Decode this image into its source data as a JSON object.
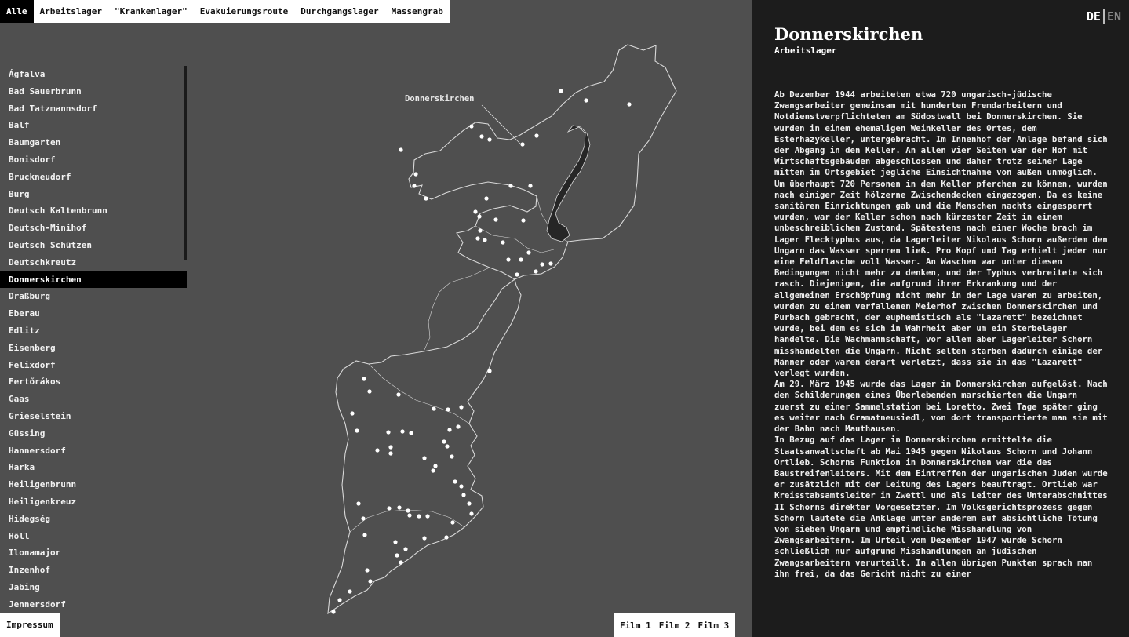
{
  "filters": [
    "Alle",
    "Arbeitslager",
    "\"Krankenlager\"",
    "Evakuierungsroute",
    "Durchgangslager",
    "Massengrab"
  ],
  "active_filter": "Alle",
  "places": [
    "Ágfalva",
    "Bad Sauerbrunn",
    "Bad Tatzmannsdorf",
    "Balf",
    "Baumgarten",
    "Bonisdorf",
    "Bruckneudorf",
    "Burg",
    "Deutsch Kaltenbrunn",
    "Deutsch-Minihof",
    "Deutsch Schützen",
    "Deutschkreutz",
    "Donnerskirchen",
    "Draßburg",
    "Eberau",
    "Edlitz",
    "Eisenberg",
    "Felixdorf",
    "Fertőrákos",
    "Gaas",
    "Grieselstein",
    "Güssing",
    "Hannersdorf",
    "Harka",
    "Heiligenbrunn",
    "Heiligenkreuz",
    "Hidegség",
    "Höll",
    "Ilonamajor",
    "Inzenhof",
    "Jabing",
    "Jennersdorf"
  ],
  "active_place": "Donnerskirchen",
  "map": {
    "callout_label": "Donnerskirchen",
    "colors": {
      "background": "#4f4f4f",
      "border": "#d8d8d8",
      "lake": "#262626",
      "marker": "#ffffff"
    }
  },
  "footer": {
    "impressum": "Impressum",
    "films": [
      "Film 1",
      "Film 2",
      "Film 3"
    ]
  },
  "language": {
    "de": "DE",
    "en": "EN",
    "active": "DE"
  },
  "info": {
    "title": "Donnerskirchen",
    "subtitle": "Arbeitslager",
    "paragraphs": [
      "Ab Dezember 1944 arbeiteten etwa 720 ungarisch-jüdische Zwangsarbeiter gemeinsam mit hunderten Fremdarbeitern und Notdienstverpflichteten am Südostwall bei Donnerskirchen. Sie wurden in einem ehemaligen Weinkeller des Ortes, dem Esterhazykeller, untergebracht. Im Innenhof der Anlage befand sich der Abgang in den Keller. An allen vier Seiten war der Hof mit Wirtschaftsgebäuden abgeschlossen und daher trotz seiner Lage mitten im Ortsgebiet jegliche Einsichtnahme von außen unmöglich. Um überhaupt 720 Personen in den Keller pferchen zu können, wurden nach einiger Zeit hölzerne Zwischendecken eingezogen. Da es keine sanitären Einrichtungen gab und die Menschen nachts eingesperrt wurden, war der Keller schon nach kürzester Zeit in einem unbeschreiblichen Zustand. Spätestens nach einer Woche brach im Lager Flecktyphus aus, da Lagerleiter Nikolaus Schorn außerdem den Ungarn das Wasser sperren ließ. Pro Kopf und Tag erhielt jeder nur eine Feldflasche voll Wasser. An Waschen war unter diesen Bedingungen nicht mehr zu denken, und der Typhus verbreitete sich rasch. Diejenigen, die aufgrund ihrer Erkrankung und der allgemeinen Erschöpfung nicht mehr in der Lage waren zu arbeiten, wurden zu einem verfallenen Meierhof zwischen Donnerskirchen und Purbach gebracht, der euphemistisch als \"Lazarett\" bezeichnet wurde, bei dem es sich in Wahrheit aber um ein Sterbelager handelte. Die Wachmannschaft, vor allem aber Lagerleiter Schorn misshandelten die Ungarn. Nicht selten starben dadurch einige der Männer oder waren derart verletzt, dass sie in das \"Lazarett\" verlegt wurden.",
      "Am 29. März 1945 wurde das Lager in Donnerskirchen aufgelöst. Nach den Schilderungen eines Überlebenden marschierten die Ungarn zuerst zu einer Sammelstation bei Loretto. Zwei Tage später ging es weiter nach Gramatneusiedl, von dort transportierte man sie mit der Bahn nach Mauthausen.",
      "In Bezug auf das Lager in Donnerskirchen ermittelte die Staatsanwaltschaft ab Mai 1945 gegen Nikolaus Schorn und Johann Ortlieb. Schorns Funktion in Donnerskirchen war die des Baustreifenleiters. Mit dem Eintreffen der ungarischen Juden wurde er zusätzlich mit der Leitung des Lagers beauftragt. Ortlieb war Kreisstabsamtsleiter in Zwettl und als Leiter des Unterabschnittes II Schorns direkter Vorgesetzter. Im Volksgerichtsprozess gegen Schorn lautete die Anklage unter anderem auf absichtliche Tötung von sieben Ungarn und empfindliche Misshandlung von Zwangsarbeitern. Im Urteil vom Dezember 1947 wurde Schorn schließlich nur aufgrund Misshandlungen an jüdischen Zwangsarbeitern verurteilt. In allen übrigen Punkten sprach man ihn frei, da das Gericht nicht zu einer"
    ]
  }
}
